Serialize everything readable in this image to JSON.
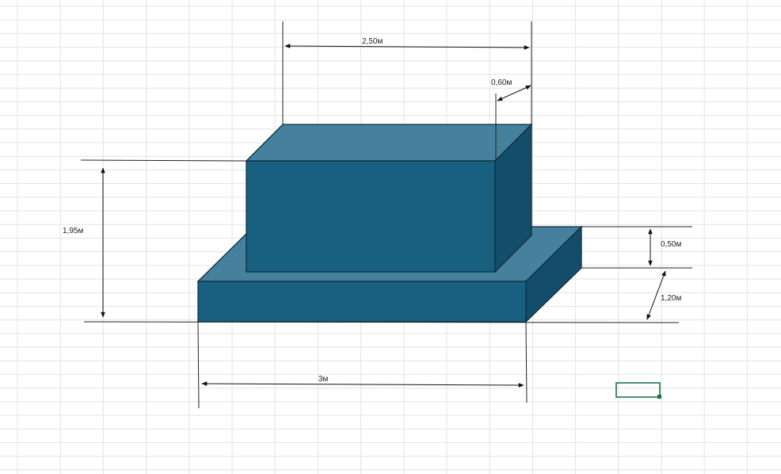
{
  "sheet": {
    "background": "#ffffff",
    "grid_color": "#e3e3e3",
    "selection_color": "#217346"
  },
  "colors": {
    "front_face": "#17607f",
    "top_face": "#45809c",
    "side_face": "#134d69",
    "edge": "#0f2f3f"
  },
  "dimensions": {
    "top_width": "2,50м",
    "top_depth": "0,60м",
    "total_height": "1,95м",
    "base_height": "0,50м",
    "base_depth": "1,20м",
    "base_width": "3м"
  }
}
